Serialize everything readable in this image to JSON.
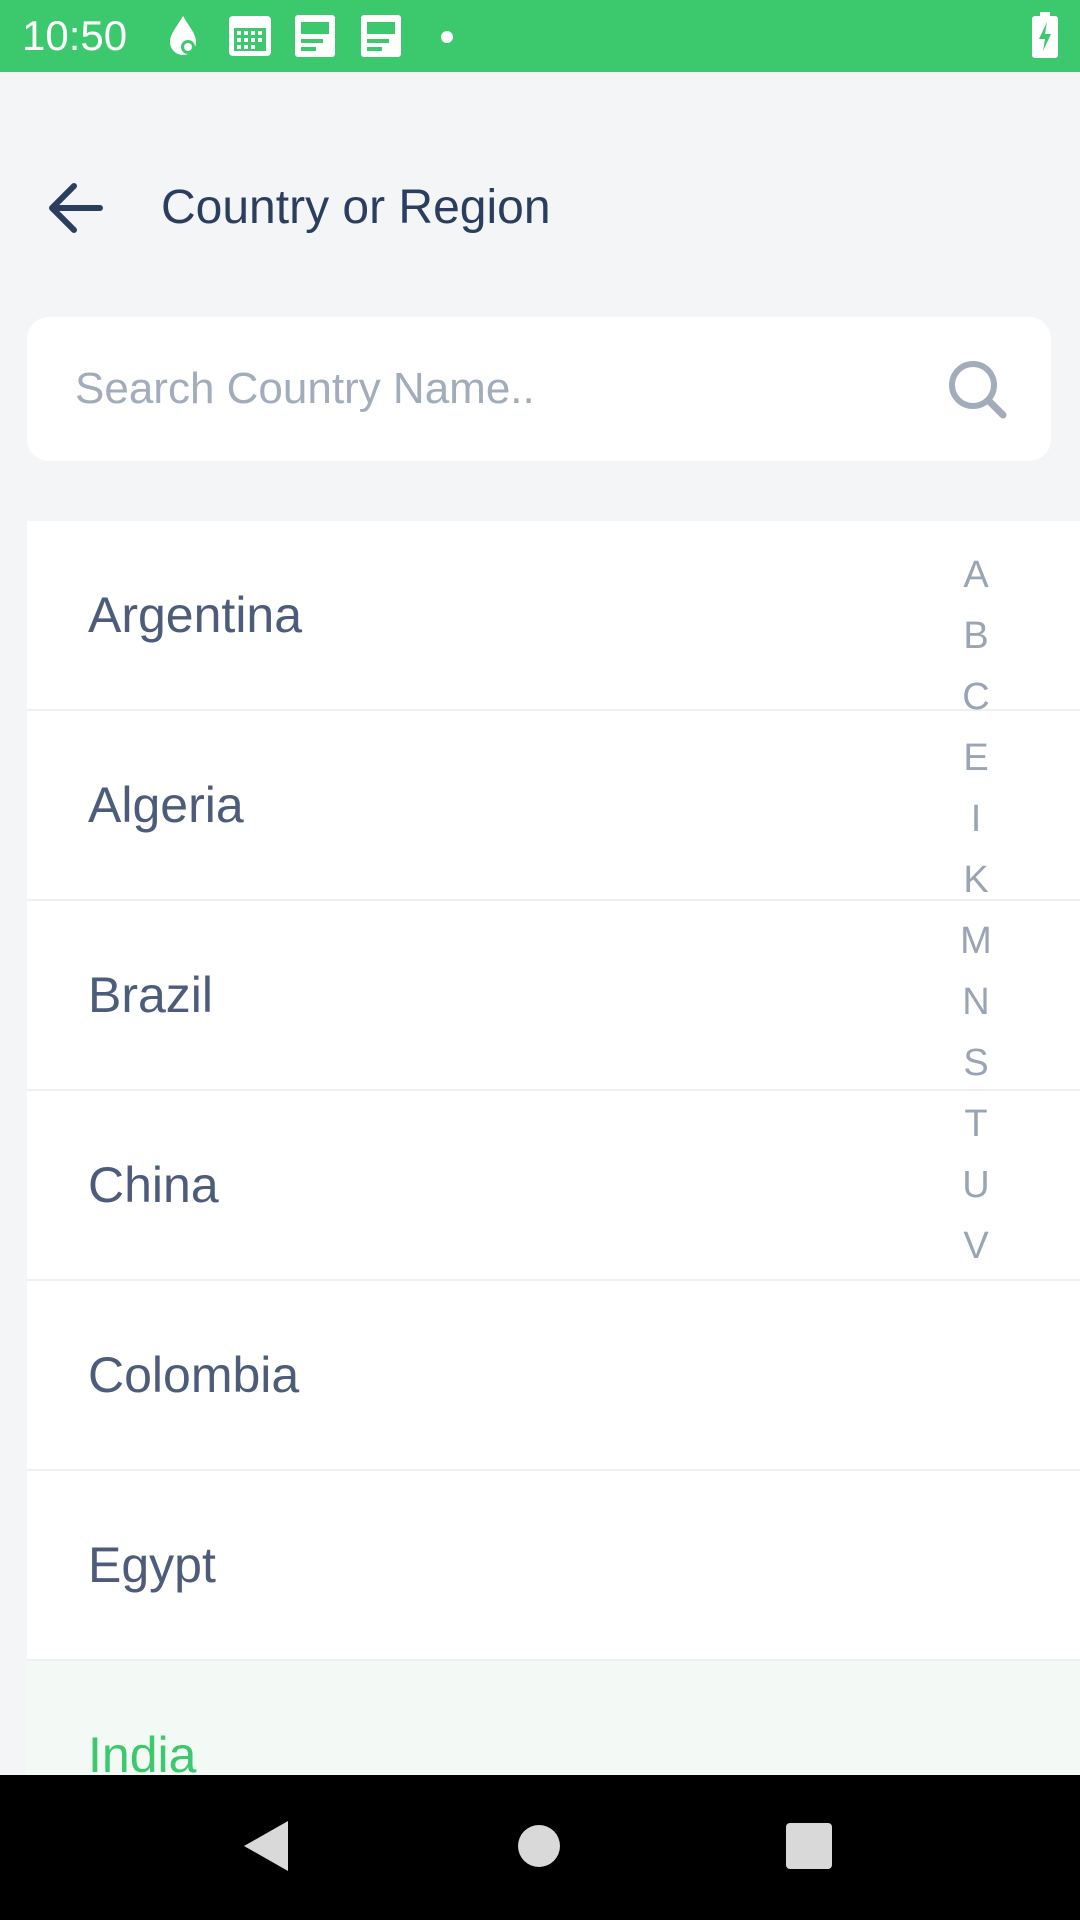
{
  "status_bar": {
    "time": "10:50",
    "bg_color": "#3cc96d",
    "icons": [
      "notification-drop-icon",
      "calendar-icon",
      "document-icon",
      "document-icon",
      "dot-icon",
      "battery-charging-icon"
    ]
  },
  "header": {
    "title": "Country or Region",
    "back_icon": "arrow-left-icon"
  },
  "search": {
    "placeholder": "Search Country Name..",
    "value": "",
    "icon": "search-icon"
  },
  "countries": [
    {
      "name": "Argentina",
      "selected": false
    },
    {
      "name": "Algeria",
      "selected": false
    },
    {
      "name": "Brazil",
      "selected": false
    },
    {
      "name": "China",
      "selected": false
    },
    {
      "name": "Colombia",
      "selected": false
    },
    {
      "name": "Egypt",
      "selected": false
    },
    {
      "name": "India",
      "selected": true
    }
  ],
  "alpha_index": [
    "A",
    "B",
    "C",
    "E",
    "I",
    "K",
    "M",
    "N",
    "S",
    "T",
    "U",
    "V"
  ],
  "colors": {
    "accent": "#3cc96d",
    "title_text": "#2c3e5e",
    "item_text": "#4d5c7a",
    "index_text": "#9aa4b4",
    "page_bg": "#f3f5f7"
  },
  "nav_bar": {
    "buttons": [
      "back-triangle-icon",
      "home-circle-icon",
      "recents-square-icon"
    ]
  }
}
